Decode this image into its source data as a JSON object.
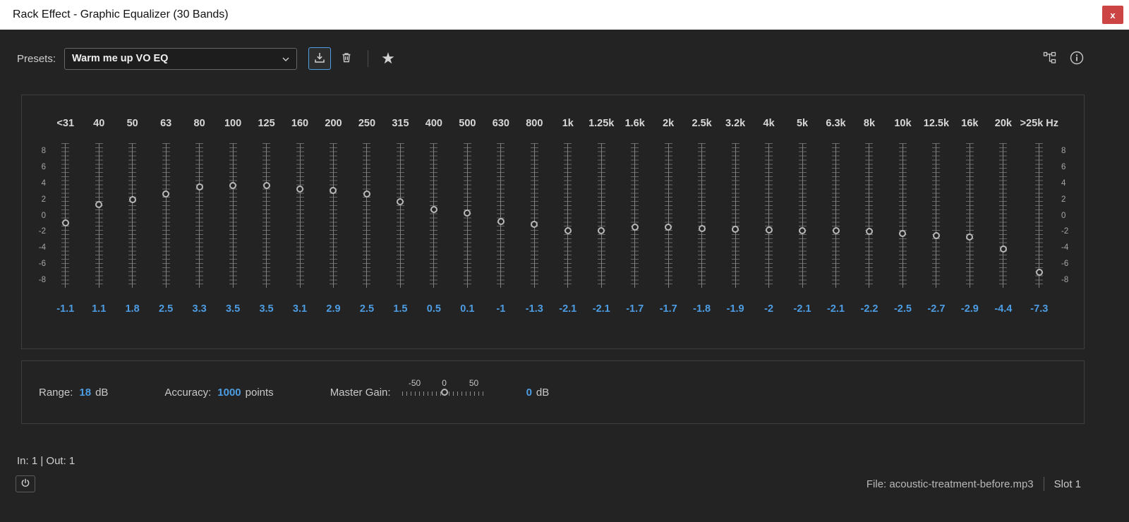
{
  "window": {
    "title": "Rack Effect - Graphic Equalizer (30 Bands)",
    "close_glyph": "x"
  },
  "presets": {
    "label": "Presets:",
    "selected": "Warm me up VO EQ"
  },
  "toolbar": {
    "icons": [
      "save-preset-icon",
      "trash-icon",
      "star-icon",
      "io-routing-icon",
      "info-icon"
    ]
  },
  "equalizer": {
    "unit": "Hz",
    "scale_ticks": [
      8,
      6,
      4,
      2,
      0,
      -2,
      -4,
      -6,
      -8
    ],
    "db_max": 9,
    "bands": [
      {
        "freq": "<31",
        "gain": -1.1,
        "label": "-1.1"
      },
      {
        "freq": "40",
        "gain": 1.1,
        "label": "1.1"
      },
      {
        "freq": "50",
        "gain": 1.8,
        "label": "1.8"
      },
      {
        "freq": "63",
        "gain": 2.5,
        "label": "2.5"
      },
      {
        "freq": "80",
        "gain": 3.3,
        "label": "3.3"
      },
      {
        "freq": "100",
        "gain": 3.5,
        "label": "3.5"
      },
      {
        "freq": "125",
        "gain": 3.5,
        "label": "3.5"
      },
      {
        "freq": "160",
        "gain": 3.1,
        "label": "3.1"
      },
      {
        "freq": "200",
        "gain": 2.9,
        "label": "2.9"
      },
      {
        "freq": "250",
        "gain": 2.5,
        "label": "2.5"
      },
      {
        "freq": "315",
        "gain": 1.5,
        "label": "1.5"
      },
      {
        "freq": "400",
        "gain": 0.5,
        "label": "0.5"
      },
      {
        "freq": "500",
        "gain": 0.1,
        "label": "0.1"
      },
      {
        "freq": "630",
        "gain": -1,
        "label": "-1"
      },
      {
        "freq": "800",
        "gain": -1.3,
        "label": "-1.3"
      },
      {
        "freq": "1k",
        "gain": -2.1,
        "label": "-2.1"
      },
      {
        "freq": "1.25k",
        "gain": -2.1,
        "label": "-2.1"
      },
      {
        "freq": "1.6k",
        "gain": -1.7,
        "label": "-1.7"
      },
      {
        "freq": "2k",
        "gain": -1.7,
        "label": "-1.7"
      },
      {
        "freq": "2.5k",
        "gain": -1.8,
        "label": "-1.8"
      },
      {
        "freq": "3.2k",
        "gain": -1.9,
        "label": "-1.9"
      },
      {
        "freq": "4k",
        "gain": -2,
        "label": "-2"
      },
      {
        "freq": "5k",
        "gain": -2.1,
        "label": "-2.1"
      },
      {
        "freq": "6.3k",
        "gain": -2.1,
        "label": "-2.1"
      },
      {
        "freq": "8k",
        "gain": -2.2,
        "label": "-2.2"
      },
      {
        "freq": "10k",
        "gain": -2.5,
        "label": "-2.5"
      },
      {
        "freq": "12.5k",
        "gain": -2.7,
        "label": "-2.7"
      },
      {
        "freq": "16k",
        "gain": -2.9,
        "label": "-2.9"
      },
      {
        "freq": "20k",
        "gain": -4.4,
        "label": "-4.4"
      },
      {
        "freq": ">25k",
        "gain": -7.3,
        "label": "-7.3"
      }
    ]
  },
  "controls": {
    "range_label": "Range:",
    "range_value": "18",
    "range_unit": "dB",
    "accuracy_label": "Accuracy:",
    "accuracy_value": "1000",
    "accuracy_unit": "points",
    "master_gain_label": "Master Gain:",
    "master_gain_scale": [
      "-50",
      "0",
      "50"
    ],
    "master_gain_value": "0",
    "master_gain_unit": "dB"
  },
  "footer": {
    "io_text": "In: 1 | Out: 1",
    "file_label": "File: acoustic-treatment-before.mp3",
    "slot_label": "Slot 1"
  },
  "colors": {
    "accent_blue": "#4d9de4",
    "close_red": "#cc4444",
    "panel_bg": "#232323"
  }
}
